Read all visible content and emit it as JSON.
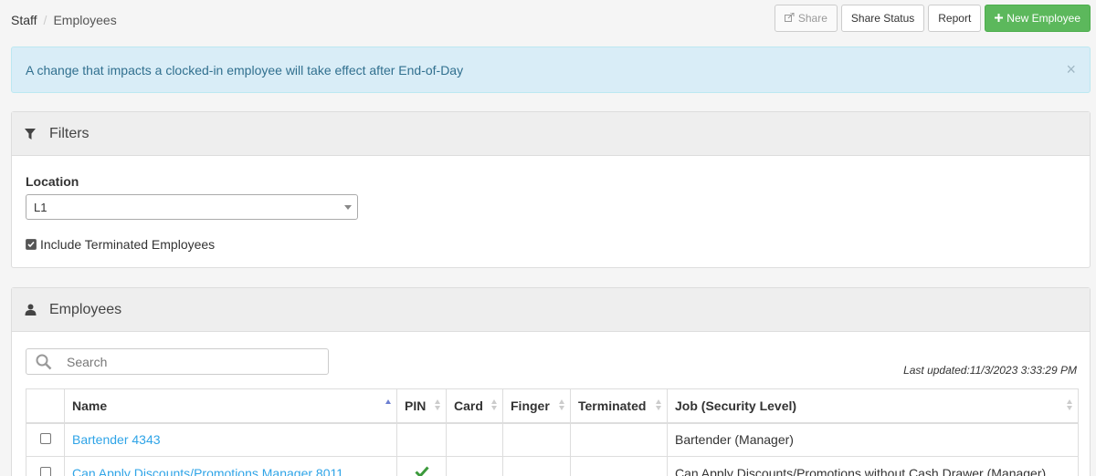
{
  "breadcrumb": {
    "root": "Staff",
    "separator": "/",
    "current": "Employees"
  },
  "toolbar": {
    "share_label": "Share",
    "share_status_label": "Share Status",
    "report_label": "Report",
    "new_employee_label": "New Employee"
  },
  "alert": {
    "message": "A change that impacts a clocked-in employee will take effect after End-of-Day",
    "close": "×"
  },
  "filters": {
    "title": "Filters",
    "location_label": "Location",
    "location_value": "L1",
    "include_terminated_label": "Include Terminated Employees",
    "include_terminated_checked": true
  },
  "employees": {
    "title": "Employees",
    "search_placeholder": "Search",
    "last_updated": "Last updated:11/3/2023 3:33:29 PM",
    "columns": [
      "Name",
      "PIN",
      "Card",
      "Finger",
      "Terminated",
      "Job (Security Level)"
    ],
    "rows": [
      {
        "name": "Bartender 4343",
        "pin": false,
        "card": "",
        "finger": "",
        "terminated": "",
        "job": "Bartender (Manager)"
      },
      {
        "name": "Can Apply Discounts/Promotions Manager 8011",
        "pin": true,
        "card": "",
        "finger": "",
        "terminated": "",
        "job": "Can Apply Discounts/Promotions without Cash Drawer (Manager)"
      }
    ]
  },
  "colors": {
    "accent_link": "#2fa4e7",
    "success": "#5cb85c",
    "alert_bg": "#d9edf7",
    "alert_text": "#31708f",
    "pin_check": "#3c9a3c"
  },
  "icons": [
    "external-share-icon",
    "plus-icon",
    "close-icon",
    "filter-funnel-icon",
    "user-icon",
    "search-icon",
    "sort-icon",
    "check-icon",
    "chevron-down-icon"
  ]
}
